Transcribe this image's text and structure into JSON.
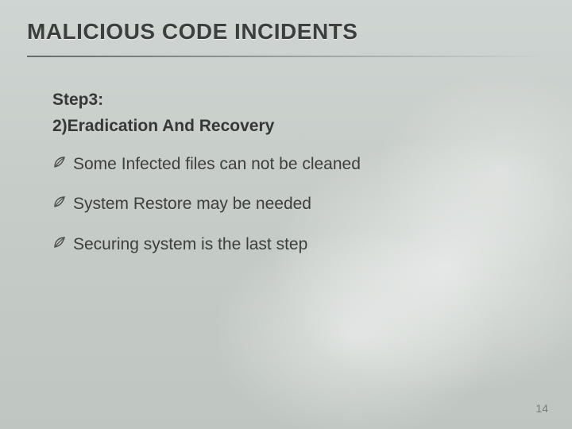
{
  "title": "MALICIOUS CODE INCIDENTS",
  "subtitle_line1": "Step3:",
  "subtitle_line2": "2)Eradication  And Recovery",
  "bullets": [
    "Some  Infected files can not be cleaned",
    "System  Restore may be needed",
    "Securing  system is the last step"
  ],
  "page_number": "14",
  "icons": {
    "leaf": "leaf-bullet-icon"
  }
}
